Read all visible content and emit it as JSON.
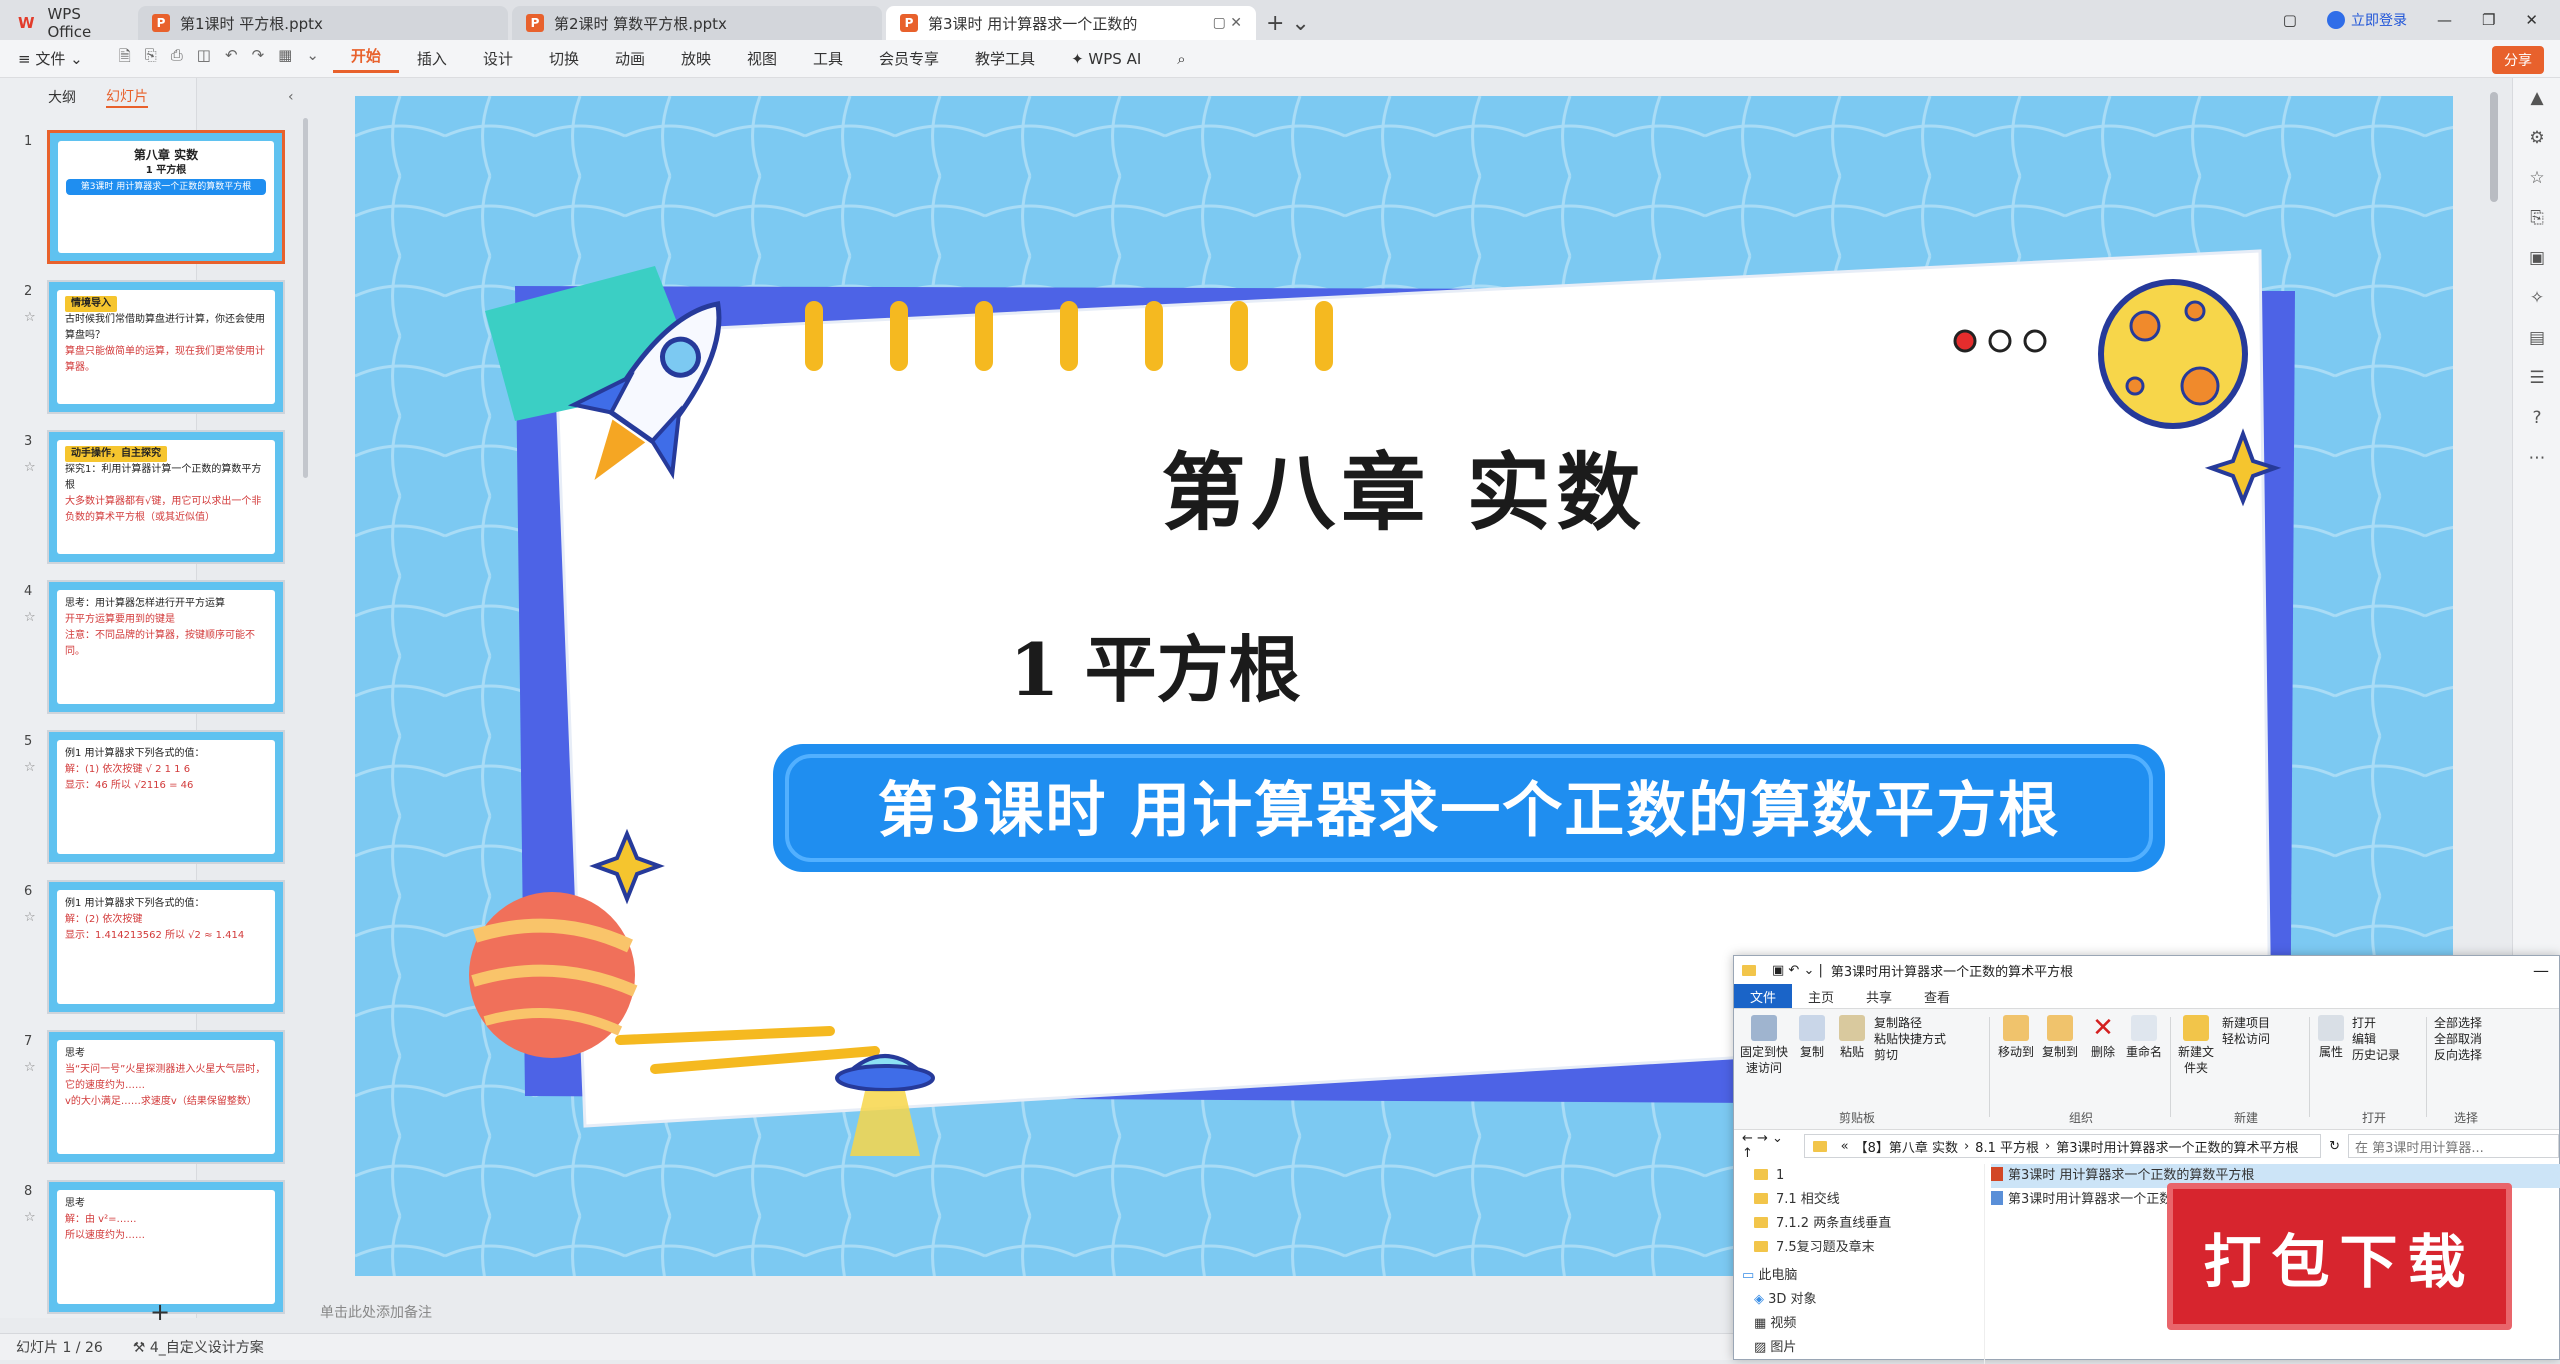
{
  "tabs": [
    {
      "label": "WPS Office"
    },
    {
      "label": "第1课时 平方根.pptx"
    },
    {
      "label": "第2课时 算数平方根.pptx"
    },
    {
      "label": "第3课时 用计算器求一个正数的"
    }
  ],
  "window": {
    "login": "立即登录"
  },
  "menu": {
    "file": "文件",
    "items": [
      "开始",
      "插入",
      "设计",
      "切换",
      "动画",
      "放映",
      "视图",
      "工具",
      "会员专享",
      "教学工具"
    ],
    "wps_ai": "WPS AI",
    "share": "分享"
  },
  "panel": {
    "tab_outline": "大纲",
    "tab_slides": "幻灯片"
  },
  "thumbnails": [
    {
      "num": "1",
      "l1": "第八章 实数",
      "l2": "1 平方根",
      "l3": "第3课时 用计算器求一个正数的算数平方根"
    },
    {
      "num": "2",
      "tag": "情境导入",
      "l1": "古时候我们常借助算盘进行计算，你还会使用算盘吗？",
      "l2": "算盘只能做简单的运算，现在我们更常使用计算器。"
    },
    {
      "num": "3",
      "tag": "动手操作，自主探究",
      "l1": "探究1：利用计算器计算一个正数的算数平方根",
      "l2": "大多数计算器都有√键，用它可以求出一个非负数的算术平方根（或其近似值）"
    },
    {
      "num": "4",
      "l1": "思考：用计算器怎样进行开平方运算",
      "l2": "开平方运算要用到的键是",
      "l3": "注意：不同品牌的计算器，按键顺序可能不同。"
    },
    {
      "num": "5",
      "l1": "例1 用计算器求下列各式的值：",
      "l2": "解：(1) 依次按键 √ 2 1 1 6",
      "l3": "显示：46   所以 √2116 = 46"
    },
    {
      "num": "6",
      "l1": "例1 用计算器求下列各式的值：",
      "l2": "解：(2) 依次按键",
      "l3": "显示：1.414213562   所以 √2 ≈ 1.414"
    },
    {
      "num": "7",
      "l1": "思考",
      "l2": "当“天问一号”火星探测器进入火星大气层时，它的速度约为……",
      "l3": "v的大小满足……求速度v（结果保留整数）"
    },
    {
      "num": "8",
      "l1": "思考",
      "l2": "解：由 v²=……",
      "l3": "所以速度约为……"
    }
  ],
  "slide": {
    "title": "第八章 实数",
    "subtitle": "1 平方根",
    "lesson": "第3课时  用计算器求一个正数的算数平方根"
  },
  "note": "单击此处添加备注",
  "status": {
    "slide": "幻灯片 1 / 26",
    "design": "4_自定义设计方案"
  },
  "explorer": {
    "title": "第3课时用计算器求一个正数的算术平方根",
    "tabs": [
      "文件",
      "主页",
      "共享",
      "查看"
    ],
    "ribbon": {
      "pin": "固定到快速访问",
      "copy": "复制",
      "paste": "粘贴",
      "copy_path": "复制路径",
      "paste_shortcut": "粘贴快捷方式",
      "cut": "剪切",
      "move_to": "移动到",
      "copy_to": "复制到",
      "delete": "删除",
      "rename": "重命名",
      "new_folder": "新建文件夹",
      "new_item": "新建项目",
      "easy_access": "轻松访问",
      "properties": "属性",
      "open": "打开",
      "edit": "编辑",
      "history": "历史记录",
      "select_all": "全部选择",
      "select_none": "全部取消",
      "invert": "反向选择",
      "grp_clipboard": "剪贴板",
      "grp_organize": "组织",
      "grp_new": "新建",
      "grp_open": "打开",
      "grp_select": "选择"
    },
    "path": [
      "«",
      "【8】第八章 实数",
      "8.1 平方根",
      "第3课时用计算器求一个正数的算术平方根"
    ],
    "search": "在 第3课时用计算器...",
    "tree": [
      "1",
      "7.1 相交线",
      "7.1.2 两条直线垂直",
      "7.5复习题及章末",
      "此电脑",
      "3D 对象",
      "视频",
      "图片"
    ],
    "files": [
      "第3课时 用计算器求一个正数的算数平方根",
      "第3课时用计算器求一个正数的算术平方根"
    ]
  },
  "banner": "打包下载",
  "colors": {
    "accent": "#e8612c",
    "slide_bg": "#7cc9f2",
    "lesson_bar": "#1f8ef0",
    "banner": "#d7252e"
  }
}
